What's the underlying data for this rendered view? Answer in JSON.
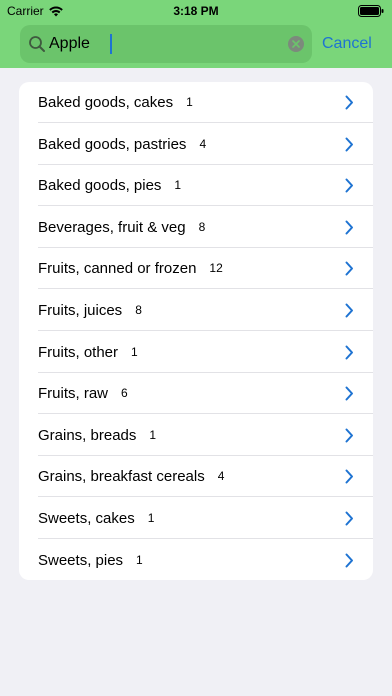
{
  "status_bar": {
    "carrier": "Carrier",
    "time": "3:18 PM"
  },
  "search": {
    "value": "Apple",
    "cancel_label": "Cancel"
  },
  "results": [
    {
      "label": "Baked goods, cakes",
      "count": "1"
    },
    {
      "label": "Baked goods, pastries",
      "count": "4"
    },
    {
      "label": "Baked goods, pies",
      "count": "1"
    },
    {
      "label": "Beverages, fruit & veg",
      "count": "8"
    },
    {
      "label": "Fruits, canned or frozen",
      "count": "12"
    },
    {
      "label": "Fruits, juices",
      "count": "8"
    },
    {
      "label": "Fruits, other",
      "count": "1"
    },
    {
      "label": "Fruits, raw",
      "count": "6"
    },
    {
      "label": "Grains, breads",
      "count": "1"
    },
    {
      "label": "Grains, breakfast cereals",
      "count": "4"
    },
    {
      "label": "Sweets, cakes",
      "count": "1"
    },
    {
      "label": "Sweets, pies",
      "count": "1"
    }
  ],
  "colors": {
    "header": "#7ad67a",
    "accent": "#1e73d2",
    "background": "#f0f0f5"
  },
  "icons": {
    "wifi": "wifi-icon",
    "battery": "battery-icon",
    "search": "search-icon",
    "clear": "clear-icon",
    "chevron": "chevron-right-icon"
  }
}
